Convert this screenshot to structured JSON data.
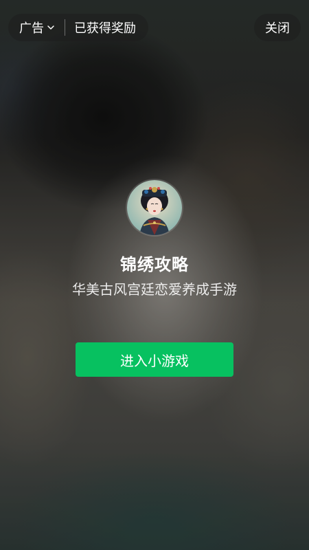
{
  "top_bar": {
    "ad_label": "广告",
    "reward_status": "已获得奖励",
    "close_label": "关闭"
  },
  "game": {
    "icon": "portrait-avatar-icon",
    "title": "锦绣攻略",
    "description": "华美古风宫廷恋爱养成手游",
    "enter_label": "进入小游戏"
  },
  "colors": {
    "accent_green": "#07c160",
    "pill_bg": "rgba(30,30,30,0.55)",
    "text": "#ffffff"
  }
}
